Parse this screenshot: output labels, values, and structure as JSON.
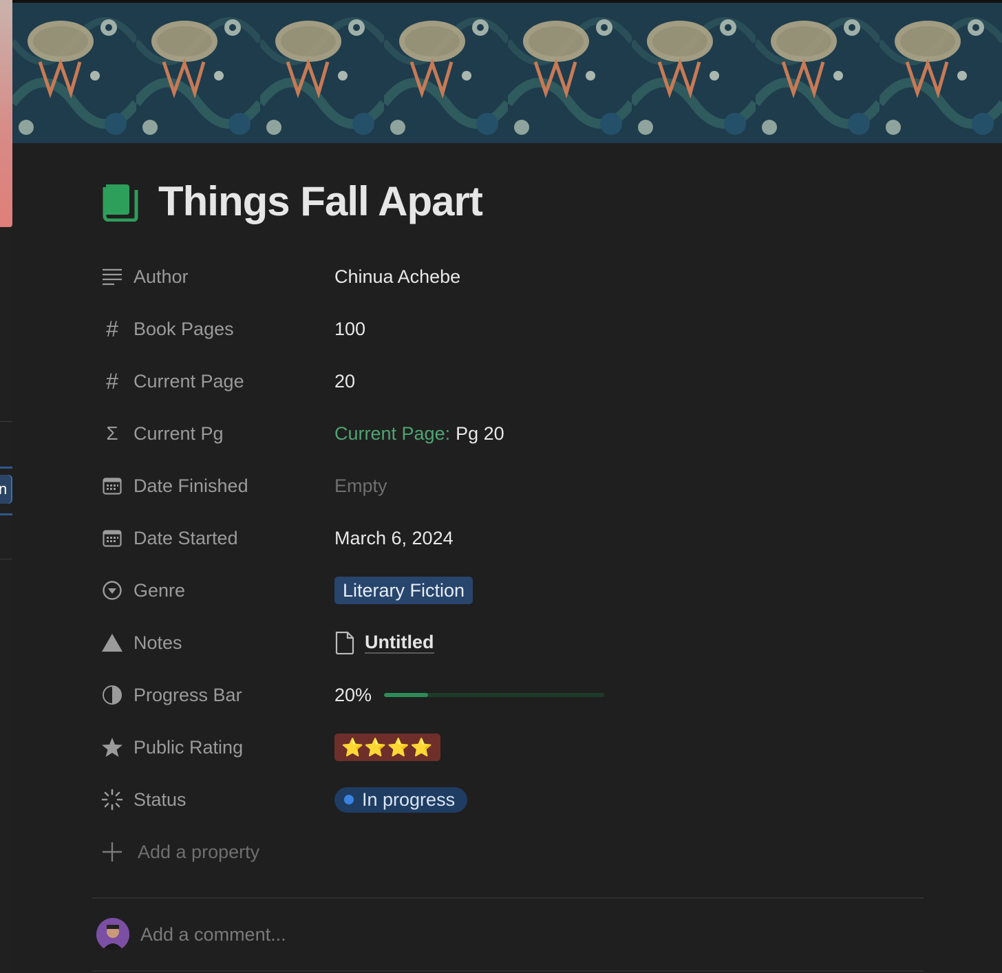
{
  "page": {
    "title": "Things Fall Apart",
    "icon": "book-icon",
    "accent_color": "#2e9e5b"
  },
  "properties": [
    {
      "key": "Author",
      "icon": "text-lines-icon",
      "value": "Chinua Achebe"
    },
    {
      "key": "Book Pages",
      "icon": "hash-icon",
      "value": "100"
    },
    {
      "key": "Current Page",
      "icon": "hash-icon",
      "value": "20"
    },
    {
      "key": "Current Pg",
      "icon": "sigma-icon",
      "formula_label": "Current Page:",
      "value": "Pg 20"
    },
    {
      "key": "Date Finished",
      "icon": "calendar-icon",
      "value": "Empty"
    },
    {
      "key": "Date Started",
      "icon": "calendar-icon",
      "value": "March 6, 2024"
    },
    {
      "key": "Genre",
      "icon": "select-icon",
      "value": "Literary Fiction"
    },
    {
      "key": "Notes",
      "icon": "relation-icon",
      "value": "Untitled"
    },
    {
      "key": "Progress Bar",
      "icon": "pie-icon",
      "value": "20%",
      "progress": 0.2
    },
    {
      "key": "Public Rating",
      "icon": "star-icon",
      "value": "⭐⭐⭐⭐",
      "rating": 4
    },
    {
      "key": "Status",
      "icon": "status-icon",
      "value": "In progress"
    }
  ],
  "add_property_label": "Add a property",
  "comment": {
    "placeholder": "Add a comment..."
  },
  "sidebar": {
    "active_item_fragment": "n"
  }
}
